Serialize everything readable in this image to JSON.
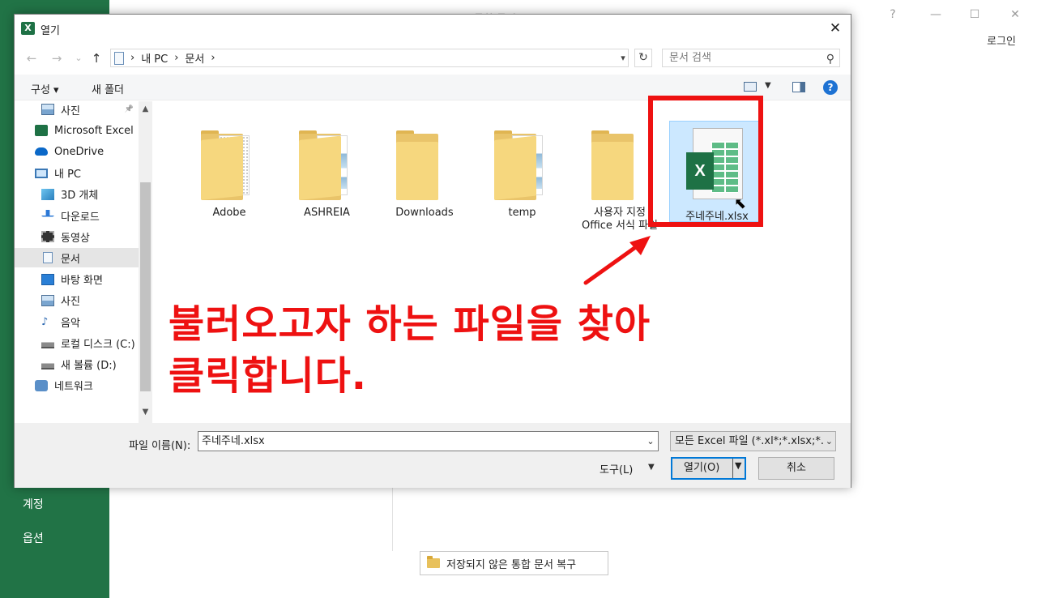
{
  "excel": {
    "title": "통합 문서1 - Excel",
    "login": "로그인",
    "nav": [
      "계정",
      "옵션"
    ],
    "recover_button": "저장되지 않은 통합 문서 복구",
    "window_controls": [
      "?",
      "—",
      "☐",
      "✕"
    ]
  },
  "dialog": {
    "title": "열기",
    "title_icon": "X",
    "close_glyph": "✕",
    "nav_back": "←",
    "nav_forward": "→",
    "nav_recent": "⌄",
    "nav_up": "↑",
    "breadcrumb": [
      "내 PC",
      "문서"
    ],
    "breadcrumb_sep": "›",
    "search_placeholder": "문서 검색",
    "toolbar": {
      "organize": "구성 ▾",
      "new_folder": "새 폴더",
      "help": "?"
    },
    "nav_items": [
      {
        "label": "사진",
        "icon": "picture-icon",
        "indent": true,
        "pinned": true
      },
      {
        "label": "Microsoft Excel",
        "icon": "excel-icon",
        "indent": false
      },
      {
        "label": "OneDrive",
        "icon": "cloud-icon",
        "indent": false
      },
      {
        "label": "내 PC",
        "icon": "pc-icon",
        "indent": false
      },
      {
        "label": "3D 개체",
        "icon": "cube-icon",
        "indent": true
      },
      {
        "label": "다운로드",
        "icon": "download-icon",
        "indent": true
      },
      {
        "label": "동영상",
        "icon": "video-icon",
        "indent": true
      },
      {
        "label": "문서",
        "icon": "document-icon",
        "indent": true,
        "selected": true
      },
      {
        "label": "바탕 화면",
        "icon": "desktop-icon",
        "indent": true
      },
      {
        "label": "사진",
        "icon": "picture-icon",
        "indent": true
      },
      {
        "label": "음악",
        "icon": "music-icon",
        "indent": true
      },
      {
        "label": "로컬 디스크 (C:)",
        "icon": "drive-icon",
        "indent": true
      },
      {
        "label": "새 볼륨 (D:)",
        "icon": "drive-icon",
        "indent": true
      },
      {
        "label": "네트워크",
        "icon": "network-icon",
        "indent": false
      }
    ],
    "files": [
      {
        "name": "Adobe",
        "type": "folder",
        "paper": "dots"
      },
      {
        "name": "ASHREIA",
        "type": "folder",
        "paper": "img"
      },
      {
        "name": "Downloads",
        "type": "folder",
        "paper": "none"
      },
      {
        "name": "temp",
        "type": "folder",
        "paper": "img"
      },
      {
        "name": "사용자 지정\nOffice 서식 파일",
        "type": "folder",
        "paper": "none"
      }
    ],
    "selected_file": {
      "name": "주네주네.xlsx",
      "badge": "X"
    },
    "filename_label": "파일 이름(N):",
    "filename_value": "주네주네.xlsx",
    "filetype_value": "모든 Excel 파일 (*.xl*;*.xlsx;*.xl",
    "tools_label": "도구(L)",
    "open_label": "열기(O)",
    "cancel_label": "취소"
  },
  "annotation": {
    "line1": "불러오고자 하는 파일을 찾아",
    "line2": "클릭합니다.",
    "color": "#ee1111"
  }
}
